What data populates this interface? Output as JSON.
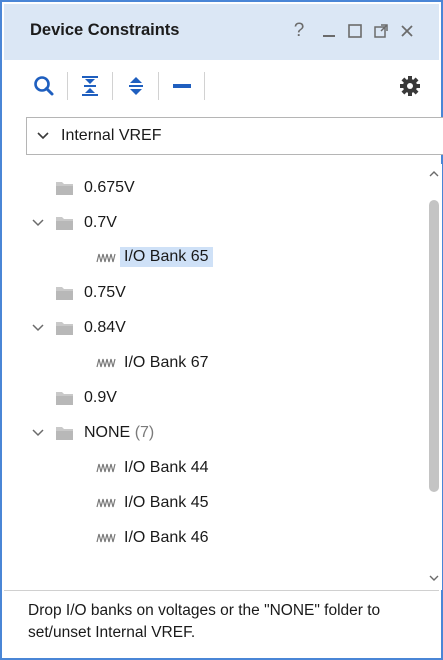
{
  "window": {
    "title": "Device Constraints",
    "controls": {
      "help": "?",
      "minimize": "_",
      "maximize": "☐",
      "float": "⧉",
      "close": "✕"
    }
  },
  "toolbar": {
    "buttons": [
      "search-icon",
      "collapse-all-icon",
      "expand-all-icon",
      "minus-icon",
      "gear-icon"
    ]
  },
  "filter": {
    "selected": "Internal VREF",
    "icon": "chevron-down-icon"
  },
  "tree": {
    "nodes": [
      {
        "label": "0.675V",
        "type": "folder",
        "expanded": false
      },
      {
        "label": "0.7V",
        "type": "folder",
        "expanded": true
      },
      {
        "label": "I/O Bank 65",
        "type": "bank",
        "selected": true
      },
      {
        "label": "0.75V",
        "type": "folder",
        "expanded": false
      },
      {
        "label": "0.84V",
        "type": "folder",
        "expanded": true
      },
      {
        "label": "I/O Bank 67",
        "type": "bank"
      },
      {
        "label": "0.9V",
        "type": "folder",
        "expanded": false
      },
      {
        "label": "NONE",
        "count": "(7)",
        "type": "folder",
        "expanded": true
      },
      {
        "label": "I/O Bank 44",
        "type": "bank"
      },
      {
        "label": "I/O Bank 45",
        "type": "bank"
      },
      {
        "label": "I/O Bank 46",
        "type": "bank"
      }
    ]
  },
  "hint": {
    "text": "Drop I/O banks on voltages or the \"NONE\" folder to set/unset Internal VREF."
  },
  "colors": {
    "accent": "#4a86d6",
    "titlebar": "#dbe7f5",
    "selection": "#cfe1f7",
    "icon_blue": "#1f5fbf"
  }
}
